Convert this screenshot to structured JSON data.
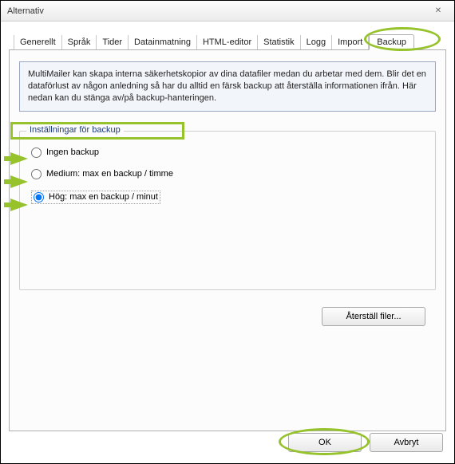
{
  "window": {
    "title": "Alternativ",
    "close_glyph": "✕"
  },
  "tabs": [
    {
      "label": "Generellt"
    },
    {
      "label": "Språk"
    },
    {
      "label": "Tider"
    },
    {
      "label": "Datainmatning"
    },
    {
      "label": "HTML-editor"
    },
    {
      "label": "Statistik"
    },
    {
      "label": "Logg"
    },
    {
      "label": "Import"
    },
    {
      "label": "Backup",
      "active": true
    }
  ],
  "infobox": {
    "text": "MultiMailer kan skapa interna säkerhetskopior av dina datafiler medan du arbetar med dem. Blir det en dataförlust av någon anledning så har du alltid en färsk backup att återställa informationen ifrån. Här nedan kan du stänga av/på backup-hanteringen."
  },
  "group": {
    "legend": "Inställningar för backup",
    "options": [
      {
        "label": "Ingen backup",
        "checked": false
      },
      {
        "label": "Medium: max en backup / timme",
        "checked": false
      },
      {
        "label": "Hög: max en backup / minut",
        "checked": true
      }
    ],
    "restore_button": "Återställ filer..."
  },
  "buttons": {
    "ok": "OK",
    "cancel": "Avbryt"
  }
}
